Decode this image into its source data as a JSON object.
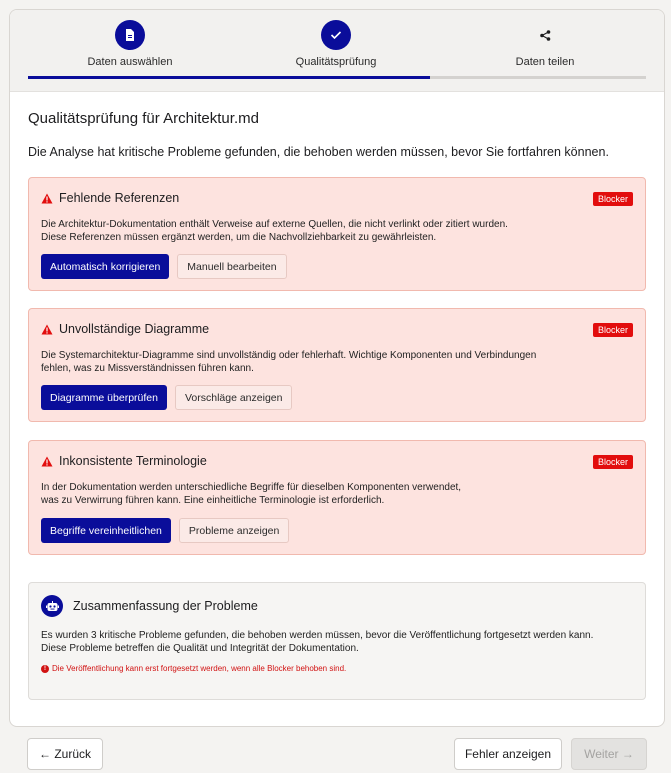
{
  "steps": [
    {
      "label": "Daten auswählen",
      "icon": "document-icon",
      "state": "done"
    },
    {
      "label": "Qualitätsprüfung",
      "icon": "check-icon",
      "state": "active"
    },
    {
      "label": "Daten teilen",
      "icon": "share-icon",
      "state": "pending"
    }
  ],
  "progress_fraction": 0.65,
  "title": "Qualitätsprüfung für Architektur.md",
  "subtitle": "Die Analyse hat kritische Probleme gefunden, die behoben werden müssen, bevor Sie fortfahren können.",
  "issues": [
    {
      "title": "Fehlende Referenzen",
      "badge": "Blocker",
      "desc_line1": "Die Architektur-Dokumentation enthält Verweise auf externe Quellen, die nicht verlinkt oder zitiert wurden.",
      "desc_line2": "Diese Referenzen müssen ergänzt werden, um die Nachvollziehbarkeit zu gewährleisten.",
      "primary": "Automatisch korrigieren",
      "secondary": "Manuell bearbeiten"
    },
    {
      "title": "Unvollständige Diagramme",
      "badge": "Blocker",
      "desc_line1": "Die Systemarchitektur-Diagramme sind unvollständig oder fehlerhaft. Wichtige Komponenten und Verbindungen",
      "desc_line2": "fehlen, was zu Missverständnissen führen kann.",
      "primary": "Diagramme überprüfen",
      "secondary": "Vorschläge anzeigen"
    },
    {
      "title": "Inkonsistente Terminologie",
      "badge": "Blocker",
      "desc_line1": "In der Dokumentation werden unterschiedliche Begriffe für dieselben Komponenten verwendet,",
      "desc_line2": "was zu Verwirrung führen kann. Eine einheitliche Terminologie ist erforderlich.",
      "primary": "Begriffe vereinheitlichen",
      "secondary": "Probleme anzeigen"
    }
  ],
  "summary": {
    "title": "Zusammenfassung der Probleme",
    "line1": "Es wurden 3 kritische Probleme gefunden, die behoben werden müssen, bevor die Veröffentlichung fortgesetzt werden kann.",
    "line2": "Diese Probleme betreffen die Qualität und Integrität der Dokumentation.",
    "note": "Die Veröffentlichung kann erst fortgesetzt werden, wenn alle Blocker behoben sind."
  },
  "footer": {
    "back": "← Zurück",
    "errors": "Fehler anzeigen",
    "next": "Weiter →"
  },
  "colors": {
    "accent": "#0a0d9a",
    "blocker": "#e20d0d",
    "issue_bg": "#fde3df"
  }
}
